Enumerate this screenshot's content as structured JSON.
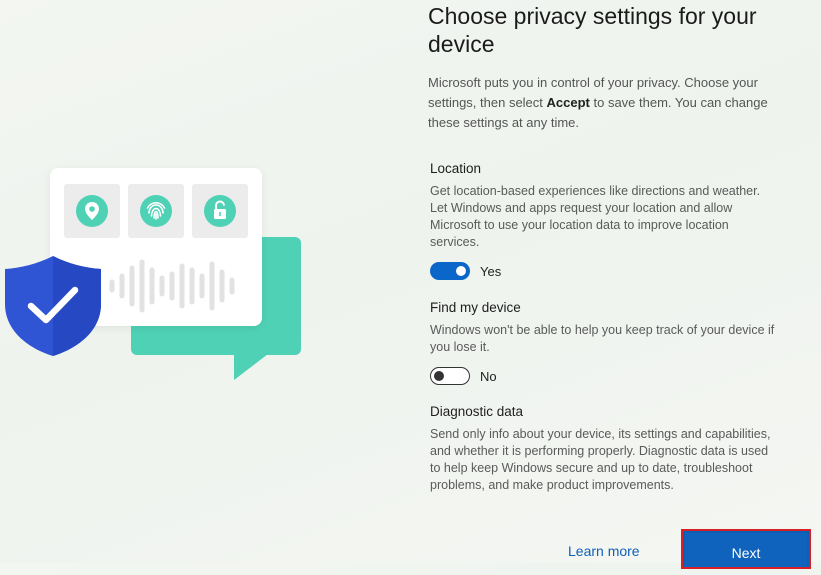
{
  "header": {
    "title": "Choose privacy settings for your device",
    "intro_before": "Microsoft puts you in control of your privacy. Choose your settings, then select ",
    "intro_bold": "Accept",
    "intro_after": " to save them. You can change these settings at any time."
  },
  "settings": [
    {
      "title": "Location",
      "description": "Get location-based experiences like directions and weather. Let Windows and apps request your location and allow Microsoft to use your location data to improve location services.",
      "toggle_on": true,
      "toggle_label": "Yes"
    },
    {
      "title": "Find my device",
      "description": "Windows won't be able to help you keep track of your device if you lose it.",
      "toggle_on": false,
      "toggle_label": "No"
    },
    {
      "title": "Diagnostic data",
      "description": "Send only info about your device, its settings and capabilities, and whether it is performing properly. Diagnostic data is used to help keep Windows secure and up to date, troubleshoot problems, and make product improvements."
    }
  ],
  "footer": {
    "learn_more": "Learn more",
    "next": "Next"
  },
  "illustration": {
    "icons": [
      "location-pin-icon",
      "fingerprint-icon",
      "unlocked-padlock-icon",
      "shield-check-icon",
      "sound-wave-icon"
    ],
    "colors": {
      "accent_teal": "#4fd1b5",
      "shield_blue": "#2f55d4",
      "toggle_blue": "#0a66c8"
    }
  }
}
